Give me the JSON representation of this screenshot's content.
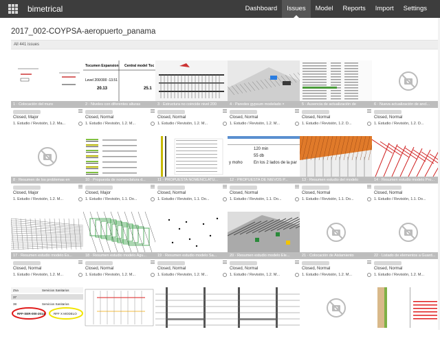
{
  "app": {
    "brand": "bimetrical"
  },
  "nav": [
    {
      "label": "Dashboard",
      "active": false
    },
    {
      "label": "Issues",
      "active": true
    },
    {
      "label": "Model",
      "active": false
    },
    {
      "label": "Reports",
      "active": false
    },
    {
      "label": "Import",
      "active": false
    },
    {
      "label": "Settings",
      "active": false
    }
  ],
  "project": {
    "title": "2017_002-COYPSA-aeropuerto_panama"
  },
  "issues_count": "All 441 issues",
  "cards": [
    {
      "caption": "1 · Colocación del muro",
      "status": "Closed, Major",
      "task": "1. Estudio / Revisión, 1.2. Ma...",
      "thumb": "plan",
      "has_image": true
    },
    {
      "caption": "2 · Niveles con diferentes alturas",
      "status": "Closed, Normal",
      "task": "1. Estudio / Revisión, 1.2. M...",
      "thumb": "text",
      "has_image": true
    },
    {
      "caption": "3 · Estructura no coincide nivel 200",
      "status": "Closed, Normal",
      "task": "1. Estudio / Revisión, 1.2. M...",
      "thumb": "section",
      "has_image": true
    },
    {
      "caption": "4 · Paredes gypsum modelado ×",
      "status": "Closed, Normal",
      "task": "1. Estudio / Revisión, 1.2. M...",
      "thumb": "3d",
      "has_image": true
    },
    {
      "caption": "5 · Ausencia de actualización de",
      "status": "Closed, Normal",
      "task": "1. Estudio / Revisión, 1.2. D...",
      "thumb": "list",
      "has_image": true
    },
    {
      "caption": "6 · Nueva actualización de ancl...",
      "status": "Closed, Normal",
      "task": "1. Estudio / Revisión, 1.2. D...",
      "thumb": "none",
      "has_image": false
    },
    {
      "caption": "8 · Resumen de los problemas en",
      "status": "Closed, Major",
      "task": "1. Estudio / Revisión, 1.2. M...",
      "thumb": "none",
      "has_image": false
    },
    {
      "caption": "10 · Propuesta de nomenclatura d...",
      "status": "Closed, Major",
      "task": "1. Estudio / Revisión, 1.1. Do...",
      "thumb": "stripes",
      "has_image": true
    },
    {
      "caption": "11 · PROPUESTA NOMENCLATU...",
      "status": "Closed, Normal",
      "task": "1. Estudio / Revisión, 1.1. Do...",
      "thumb": "table",
      "has_image": true
    },
    {
      "caption": "12 · PROPUESTA DE NIEVOS P...",
      "status": "Closed, Normal",
      "task": "1. Estudio / Revisión, 1.1. Do...",
      "thumb": "textbox",
      "has_image": true
    },
    {
      "caption": "13 · Resumen estudio del modelo",
      "status": "Closed, Normal",
      "task": "1. Estudio / Revisión, 1.1. Do...",
      "thumb": "roof",
      "has_image": true
    },
    {
      "caption": "14 · Resumen estudio modelo Pro...",
      "status": "Closed, Normal",
      "task": "1. Estudio / Revisión, 1.1. Do...",
      "thumb": "pipes",
      "has_image": true
    },
    {
      "caption": "17 · Resumen estudio modelo Es...",
      "status": "Closed, Normal",
      "task": "1. Estudio / Revisión, 1.2. M...",
      "thumb": "wire",
      "has_image": true
    },
    {
      "caption": "18 · Resumen estudio modelo Agu...",
      "status": "Closed, Normal",
      "task": "1. Estudio / Revisión, 1.2. M...",
      "thumb": "green",
      "has_image": true
    },
    {
      "caption": "19 · Resumen estudio modelo Sa...",
      "status": "Closed, Normal",
      "task": "1. Estudio / Revisión, 1.2. M...",
      "thumb": "dots",
      "has_image": true
    },
    {
      "caption": "20 · Resumen estudio modelo Ele...",
      "status": "Closed, Normal",
      "task": "1. Estudio / Revisión, 1.2. M...",
      "thumb": "mep",
      "has_image": true
    },
    {
      "caption": "21 · Colocación de Aislamiento",
      "status": "Closed, Normal",
      "task": "1. Estudio / Revisión, 1.2. M...",
      "thumb": "none",
      "has_image": false
    },
    {
      "caption": "22 · Listado de elementos a Guard...",
      "status": "Closed, Normal",
      "task": "1. Estudio / Revisión, 1.2. M...",
      "thumb": "none",
      "has_image": false
    },
    {
      "caption": "",
      "status": "",
      "task": "",
      "thumb": "sanit",
      "has_image": true
    },
    {
      "caption": "",
      "status": "",
      "task": "",
      "thumb": "sheet",
      "has_image": true
    },
    {
      "caption": "",
      "status": "",
      "task": "",
      "thumb": "detail",
      "has_image": true
    },
    {
      "caption": "",
      "status": "",
      "task": "",
      "thumb": "detail",
      "has_image": true
    },
    {
      "caption": "",
      "status": "",
      "task": "",
      "thumb": "none",
      "has_image": false
    },
    {
      "caption": "",
      "status": "",
      "task": "",
      "thumb": "wallred",
      "has_image": true
    }
  ],
  "thumb_text": {
    "tocumen": "Tocumen Expansion",
    "central": "Central model Toc",
    "level1": "Level 200/300 -13.51",
    "val1": "20.13",
    "val2": "25.1",
    "min": "120 min",
    "db": "55 db",
    "ambos": "En los 2 lados de la par",
    "ymoho": "y moho",
    "zna": "Zna",
    "sanit": "Servicios Sanitarios",
    "rff": "RFF-SER-000-2014",
    "rff2": "RFF X MODELO",
    "num37": "37",
    "num38": "38"
  },
  "colors": {
    "topbar": "#3d3d3d",
    "caption": "#bdbdbd",
    "accent_red": "#e01b1b",
    "accent_yellow": "#f2e500"
  }
}
